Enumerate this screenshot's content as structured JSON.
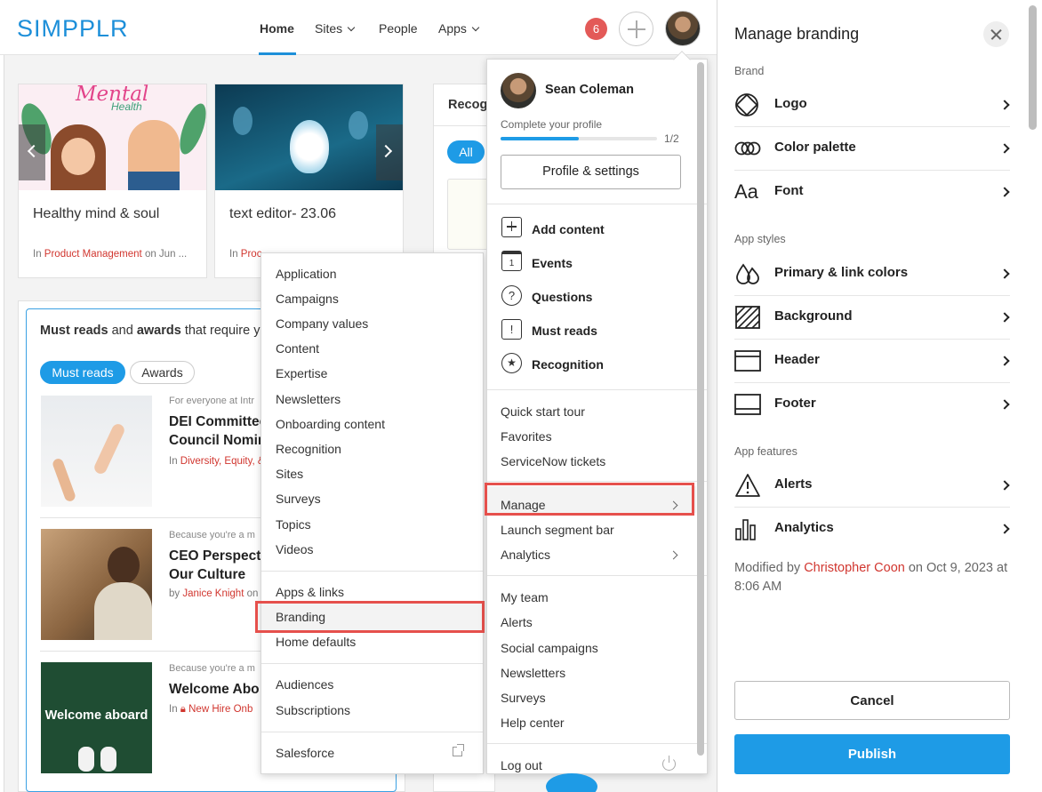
{
  "app": {
    "logo": "SIMPPLR"
  },
  "nav": {
    "home": "Home",
    "sites": "Sites",
    "people": "People",
    "apps": "Apps",
    "notifications": "6"
  },
  "carousel": [
    {
      "title": "Healthy mind & soul",
      "meta_prefix": "In ",
      "meta_link": "Product Management",
      "meta_suffix": " on Jun ...",
      "image_text_1": "Mental",
      "image_text_2": "Health"
    },
    {
      "title": "text editor- 23.06",
      "meta_prefix": "In ",
      "meta_link": "Proc"
    }
  ],
  "recognition": {
    "title": "Recog",
    "pill": "All"
  },
  "must_reads": {
    "heading_1": "Must reads",
    "heading_2": " and ",
    "heading_3": "awards",
    "heading_4": " that require y",
    "tabs": [
      "Must reads",
      "Awards"
    ],
    "items": [
      {
        "context": "For everyone at Intr",
        "title_1": "DEI Committee",
        "title_2": "Council Nomin",
        "meta_prefix": "In ",
        "meta_link": "Diversity, Equity, &"
      },
      {
        "context": "Because you're a m",
        "title_1": "CEO Perspectiv",
        "title_2": "Our Culture",
        "meta_prefix": "by ",
        "meta_link": "Janice Knight",
        "meta_suffix": " on"
      },
      {
        "context": "Because you're a m",
        "title_1": "Welcome Abo",
        "title_2": "",
        "meta_prefix": "In ",
        "meta_link": "New Hire Onb",
        "image_text": "Welcome aboard"
      }
    ]
  },
  "manage_submenu": {
    "group1": [
      "Application",
      "Campaigns",
      "Company values",
      "Content",
      "Expertise",
      "Newsletters",
      "Onboarding content",
      "Recognition",
      "Sites",
      "Surveys",
      "Topics",
      "Videos"
    ],
    "group2": [
      "Apps & links",
      "Branding",
      "Home defaults"
    ],
    "group3": [
      "Audiences",
      "Subscriptions"
    ],
    "group4": [
      "Salesforce"
    ]
  },
  "profile_menu": {
    "name": "Sean Coleman",
    "complete_label": "Complete your profile",
    "progress_text": "1/2",
    "progress_fraction": 0.5,
    "settings_button": "Profile & settings",
    "create": [
      "Add content",
      "Events",
      "Questions",
      "Must reads",
      "Recognition"
    ],
    "group2": [
      "Quick start tour",
      "Favorites",
      "ServiceNow tickets"
    ],
    "group3": [
      "Manage",
      "Launch segment bar",
      "Analytics"
    ],
    "group4": [
      "My team",
      "Alerts",
      "Social campaigns",
      "Newsletters",
      "Surveys",
      "Help center"
    ],
    "logout": "Log out"
  },
  "panel": {
    "title": "Manage branding",
    "sections": {
      "brand": "Brand",
      "app_styles": "App styles",
      "app_features": "App features"
    },
    "brand": [
      "Logo",
      "Color palette",
      "Font"
    ],
    "app_styles": [
      "Primary & link colors",
      "Background",
      "Header",
      "Footer"
    ],
    "app_features": [
      "Alerts",
      "Analytics"
    ],
    "font_icon_text": "Aa",
    "modified_prefix": "Modified by ",
    "modified_by": "Christopher Coon",
    "modified_suffix": " on Oct 9, 2023 at 8:06 AM",
    "cancel": "Cancel",
    "publish": "Publish"
  }
}
